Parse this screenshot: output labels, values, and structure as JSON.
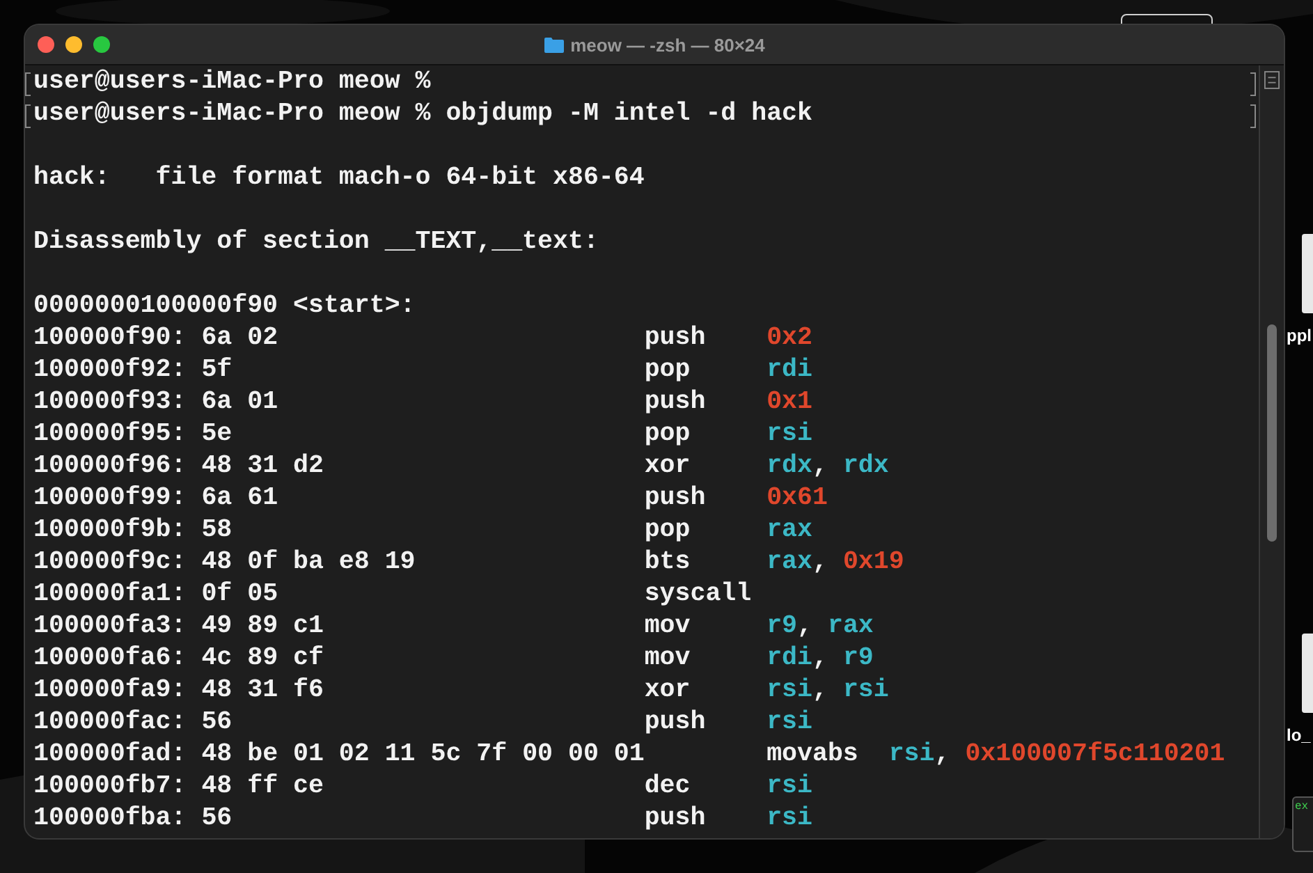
{
  "window": {
    "title": "meow — -zsh — 80×24"
  },
  "terminal": {
    "lines": [
      {
        "kind": "prompt",
        "text": "user@users-iMac-Pro meow %"
      },
      {
        "kind": "prompt",
        "text": "user@users-iMac-Pro meow % objdump -M intel -d hack"
      },
      {
        "kind": "blank"
      },
      {
        "kind": "text",
        "text": "hack:   file format mach-o 64-bit x86-64"
      },
      {
        "kind": "blank"
      },
      {
        "kind": "text",
        "text": "Disassembly of section __TEXT,__text:"
      },
      {
        "kind": "blank"
      },
      {
        "kind": "text",
        "text": "0000000100000f90 <start>:"
      },
      {
        "kind": "instruction",
        "address": "100000f90:",
        "bytes": "6a 02",
        "mnemonic": "push",
        "operands": [
          {
            "kind": "immediate",
            "text": "0x2"
          }
        ]
      },
      {
        "kind": "instruction",
        "address": "100000f92:",
        "bytes": "5f",
        "mnemonic": "pop",
        "operands": [
          {
            "kind": "register",
            "text": "rdi"
          }
        ]
      },
      {
        "kind": "instruction",
        "address": "100000f93:",
        "bytes": "6a 01",
        "mnemonic": "push",
        "operands": [
          {
            "kind": "immediate",
            "text": "0x1"
          }
        ]
      },
      {
        "kind": "instruction",
        "address": "100000f95:",
        "bytes": "5e",
        "mnemonic": "pop",
        "operands": [
          {
            "kind": "register",
            "text": "rsi"
          }
        ]
      },
      {
        "kind": "instruction",
        "address": "100000f96:",
        "bytes": "48 31 d2",
        "mnemonic": "xor",
        "operands": [
          {
            "kind": "register",
            "text": "rdx"
          },
          {
            "kind": "punct",
            "text": ","
          },
          {
            "kind": "register",
            "text": "rdx"
          }
        ]
      },
      {
        "kind": "instruction",
        "address": "100000f99:",
        "bytes": "6a 61",
        "mnemonic": "push",
        "operands": [
          {
            "kind": "immediate",
            "text": "0x61"
          }
        ]
      },
      {
        "kind": "instruction",
        "address": "100000f9b:",
        "bytes": "58",
        "mnemonic": "pop",
        "operands": [
          {
            "kind": "register",
            "text": "rax"
          }
        ]
      },
      {
        "kind": "instruction",
        "address": "100000f9c:",
        "bytes": "48 0f ba e8 19",
        "mnemonic": "bts",
        "operands": [
          {
            "kind": "register",
            "text": "rax"
          },
          {
            "kind": "punct",
            "text": ","
          },
          {
            "kind": "immediate",
            "text": "0x19"
          }
        ]
      },
      {
        "kind": "instruction",
        "address": "100000fa1:",
        "bytes": "0f 05",
        "mnemonic": "syscall"
      },
      {
        "kind": "instruction",
        "address": "100000fa3:",
        "bytes": "49 89 c1",
        "mnemonic": "mov",
        "operands": [
          {
            "kind": "register",
            "text": "r9"
          },
          {
            "kind": "punct",
            "text": ","
          },
          {
            "kind": "register",
            "text": "rax"
          }
        ]
      },
      {
        "kind": "instruction",
        "address": "100000fa6:",
        "bytes": "4c 89 cf",
        "mnemonic": "mov",
        "operands": [
          {
            "kind": "register",
            "text": "rdi"
          },
          {
            "kind": "punct",
            "text": ","
          },
          {
            "kind": "register",
            "text": "r9"
          }
        ]
      },
      {
        "kind": "instruction",
        "address": "100000fa9:",
        "bytes": "48 31 f6",
        "mnemonic": "xor",
        "operands": [
          {
            "kind": "register",
            "text": "rsi"
          },
          {
            "kind": "punct",
            "text": ","
          },
          {
            "kind": "register",
            "text": "rsi"
          }
        ]
      },
      {
        "kind": "instruction",
        "address": "100000fac:",
        "bytes": "56",
        "mnemonic": "push",
        "operands": [
          {
            "kind": "register",
            "text": "rsi"
          }
        ]
      },
      {
        "kind": "instruction",
        "address": "100000fad:",
        "bytes": "48 be 01 02 11 5c 7f 00 00 01",
        "mnemonic": "movabs",
        "operands": [
          {
            "kind": "register",
            "text": "rsi"
          },
          {
            "kind": "punct",
            "text": ","
          },
          {
            "kind": "immediate",
            "text": "0x100007f5c110201"
          }
        ]
      },
      {
        "kind": "instruction",
        "address": "100000fb7:",
        "bytes": "48 ff ce",
        "mnemonic": "dec",
        "operands": [
          {
            "kind": "register",
            "text": "rsi"
          }
        ]
      },
      {
        "kind": "instruction",
        "address": "100000fba:",
        "bytes": "56",
        "mnemonic": "push",
        "operands": [
          {
            "kind": "register",
            "text": "rsi"
          }
        ]
      }
    ]
  },
  "desktop": {
    "icons": [
      {
        "label": "ppl"
      },
      {
        "label": "lo_"
      }
    ],
    "thumbnail": {
      "text": "ex"
    }
  }
}
